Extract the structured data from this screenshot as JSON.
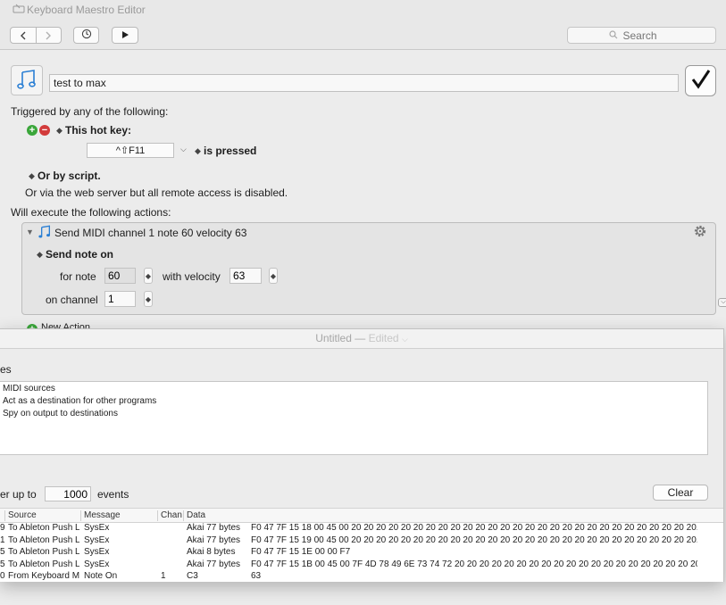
{
  "km_window": {
    "title": "Keyboard Maestro Editor",
    "toolbar": {
      "back_icon": "chevron-left-icon",
      "forward_icon": "chevron-right-icon",
      "history_icon": "clock-icon",
      "run_icon": "play-icon",
      "search_placeholder": "Search"
    },
    "macro": {
      "name": "test to max",
      "icon": "music-note-icon",
      "enabled_icon": "checkmark-icon"
    },
    "triggers": {
      "heading": "Triggered by any of the following:",
      "hotkey_label": "This hot key:",
      "hotkey_value": "^⇧F11",
      "hotkey_condition": "is pressed",
      "script_label": "Or by script.",
      "web_server_note": "Or via the web server but all remote access is disabled."
    },
    "actions": {
      "heading": "Will execute the following actions:",
      "action_title": "Send MIDI channel 1 note 60 velocity 63",
      "mode_label": "Send note on",
      "for_note_label": "for note",
      "note_value": "60",
      "with_velocity_label": "with velocity",
      "velocity_value": "63",
      "on_channel_label": "on channel",
      "channel_value": "1",
      "new_action_label": "New Action"
    }
  },
  "midi_window": {
    "title": "Untitled",
    "title_sep": "—",
    "edited": "Edited",
    "sources_label": "es",
    "sources": [
      "MIDI sources",
      "Act as a destination for other programs",
      "Spy on output to destinations"
    ],
    "buffer_label": "er up to",
    "buffer_value": "1000",
    "events_label": "events",
    "clear_label": "Clear",
    "columns": [
      "Source",
      "Message",
      "Chan",
      "Data"
    ],
    "rows": [
      {
        "idx": "9",
        "source": "To Ableton Push L",
        "message": "SysEx",
        "chan": "",
        "data1": "Akai 77 bytes",
        "data2": "F0 47 7F 15 18 00 45 00 20 20 20 20 20 20 20 20 20 20 20 20 20 20 20 20 20 20 20 20 20 20 20 20 20 20 20 20..."
      },
      {
        "idx": "1",
        "source": "To Ableton Push L",
        "message": "SysEx",
        "chan": "",
        "data1": "Akai 77 bytes",
        "data2": "F0 47 7F 15 19 00 45 00 20 20 20 20 20 20 20 20 20 20 20 20 20 20 20 20 20 20 20 20 20 20 20 20 20 20 20 20..."
      },
      {
        "idx": "5",
        "source": "To Ableton Push L",
        "message": "SysEx",
        "chan": "",
        "data1": "Akai 8 bytes",
        "data2": "F0 47 7F 15 1E 00 00 F7"
      },
      {
        "idx": "5",
        "source": "To Ableton Push L",
        "message": "SysEx",
        "chan": "",
        "data1": "Akai 77 bytes",
        "data2": "F0 47 7F 15 1B 00 45 00 7F 4D 78 49 6E 73 74 72 20 20 20 20 20 20 20 20 20 20 20 20 20 20 20 20 20 20 20 20..."
      },
      {
        "idx": "0",
        "source": "From Keyboard M",
        "message": "Note On",
        "chan": "1",
        "data1": "C3",
        "data2": "63"
      }
    ]
  },
  "colors": {
    "window_bg": "#ececec",
    "add_green": "#3aa63a",
    "remove_red": "#d23b3b",
    "icon_blue": "#2a7fd4"
  }
}
